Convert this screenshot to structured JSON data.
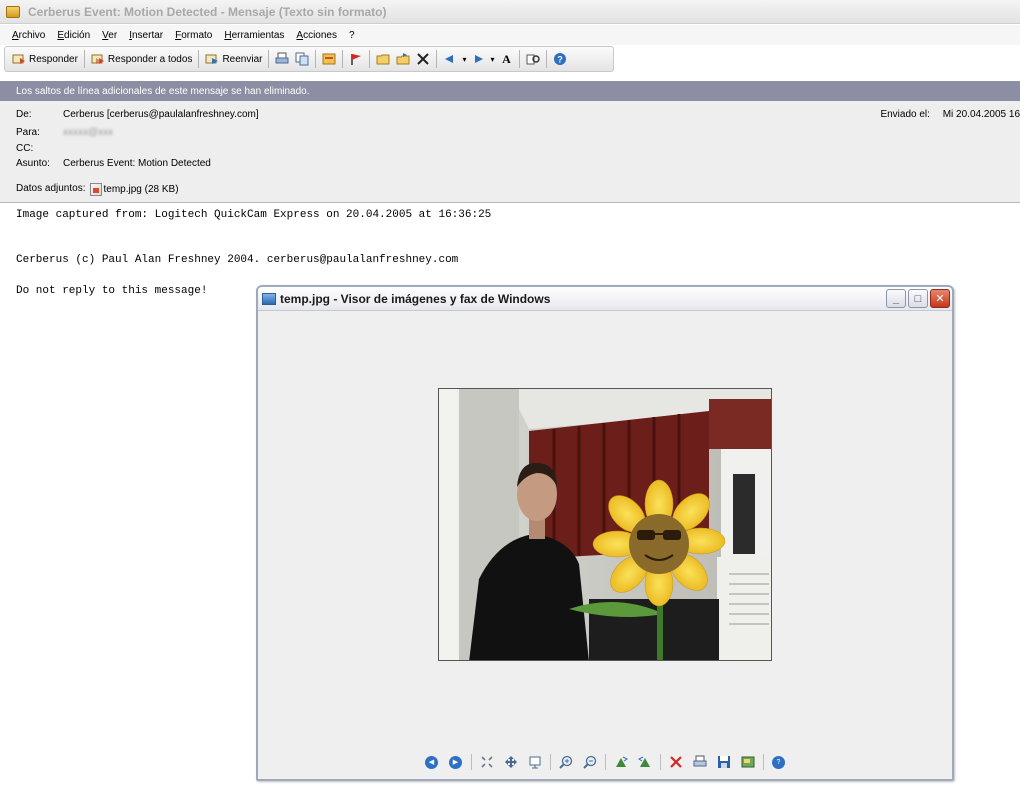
{
  "window": {
    "title": "Cerberus Event: Motion Detected - Mensaje (Texto sin formato)"
  },
  "menu": [
    "Archivo",
    "Edición",
    "Ver",
    "Insertar",
    "Formato",
    "Herramientas",
    "Acciones",
    "?"
  ],
  "toolbar": {
    "reply": "Responder",
    "reply_all": "Responder a todos",
    "forward": "Reenviar"
  },
  "infobar": "Los saltos de línea adicionales de este mensaje se han eliminado.",
  "header": {
    "from_label": "De:",
    "from_value": "Cerberus [cerberus@paulalanfreshney.com]",
    "to_label": "Para:",
    "to_value": "xxxxx@xxx",
    "cc_label": "CC:",
    "subject_label": "Asunto:",
    "subject_value": "Cerberus Event: Motion Detected",
    "attachments_label": "Datos adjuntos:",
    "attachment_file": "temp.jpg (28 KB)",
    "sent_label": "Enviado el:",
    "sent_value": "Mi 20.04.2005 16"
  },
  "body": {
    "line1": "Image captured from: Logitech QuickCam Express on 20.04.2005 at 16:36:25",
    "line2": "Cerberus (c) Paul Alan Freshney 2004. cerberus@paulalanfreshney.com",
    "line3": "Do not reply to this message!"
  },
  "viewer": {
    "title": "temp.jpg - Visor de imágenes y fax de Windows",
    "minimize": "_",
    "maximize": "□",
    "close": "✕"
  },
  "colors": {
    "infobar": "#8c8fa3",
    "header_bg": "#eeeeee",
    "viewer_border": "#9fa9be",
    "close_red": "#c5371c"
  }
}
